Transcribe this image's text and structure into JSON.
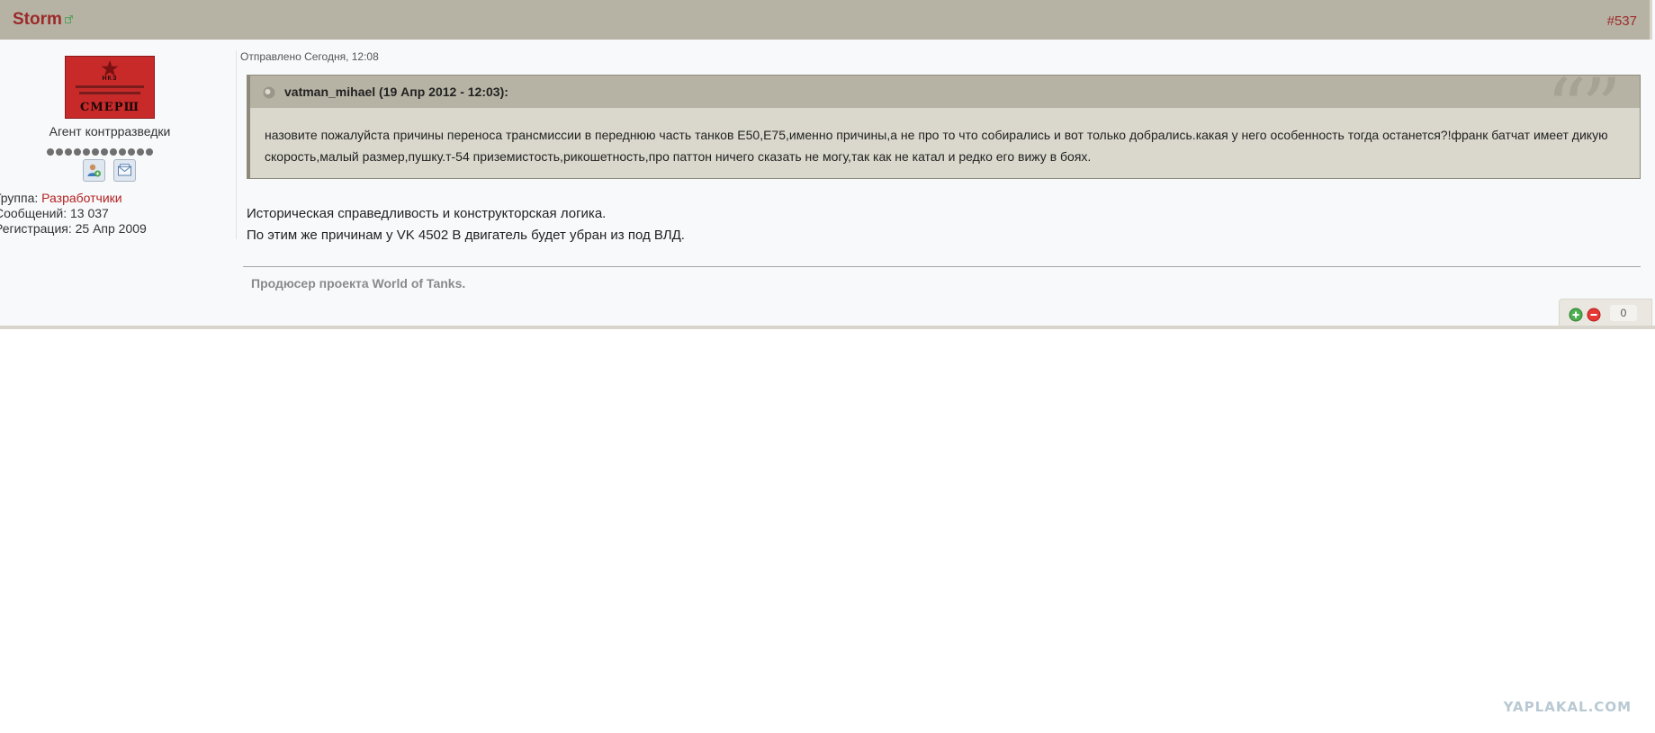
{
  "post": {
    "author": "Storm",
    "post_number": "#537",
    "posted_label": "Отправлено Сегодня, 12:08",
    "body_lines": [
      "Историческая справедливость и конструкторская логика.",
      "По этим же причинам у VK 4502 В двигатель будет убран из под ВЛД."
    ],
    "signature": "Продюсер проекта World of Tanks.",
    "reputation": "0"
  },
  "profile": {
    "avatar_text": "СМЕРШ",
    "avatar_top_text": "НКЗ",
    "rank_title": "Агент контрразведки",
    "rank_pips": 12,
    "group_label": "Группа:",
    "group_value": "Разработчики",
    "posts_label": "Сообщений:",
    "posts_value": "13 037",
    "reg_label": "Регистрация:",
    "reg_value": "25 Апр 2009"
  },
  "quote": {
    "author": "vatman_mihael (19 Апр 2012 - 12:03):",
    "text": "назовите пожалуйста причины переноса трансмиссии в переднюю часть танков Е50,Е75,именно причины,а не про то что собирались и вот только добрались.какая у него особенность тогда останется?!франк батчат имеет дикую скорость,малый размер,пушку.т-54 приземистость,рикошетность,про паттон ничего сказать не могу,так как не катал и редко его вижу в боях."
  },
  "watermark": "YAPLAKAL.COM",
  "colors": {
    "header_bg": "#b7b3a4",
    "author_red": "#9b2a2a",
    "quote_bg": "#dad8cc",
    "group_red": "#b42222"
  },
  "icons": [
    "external-link-icon",
    "user-profile-icon",
    "private-message-icon",
    "quote-icon",
    "rep-plus-icon",
    "rep-minus-icon"
  ]
}
